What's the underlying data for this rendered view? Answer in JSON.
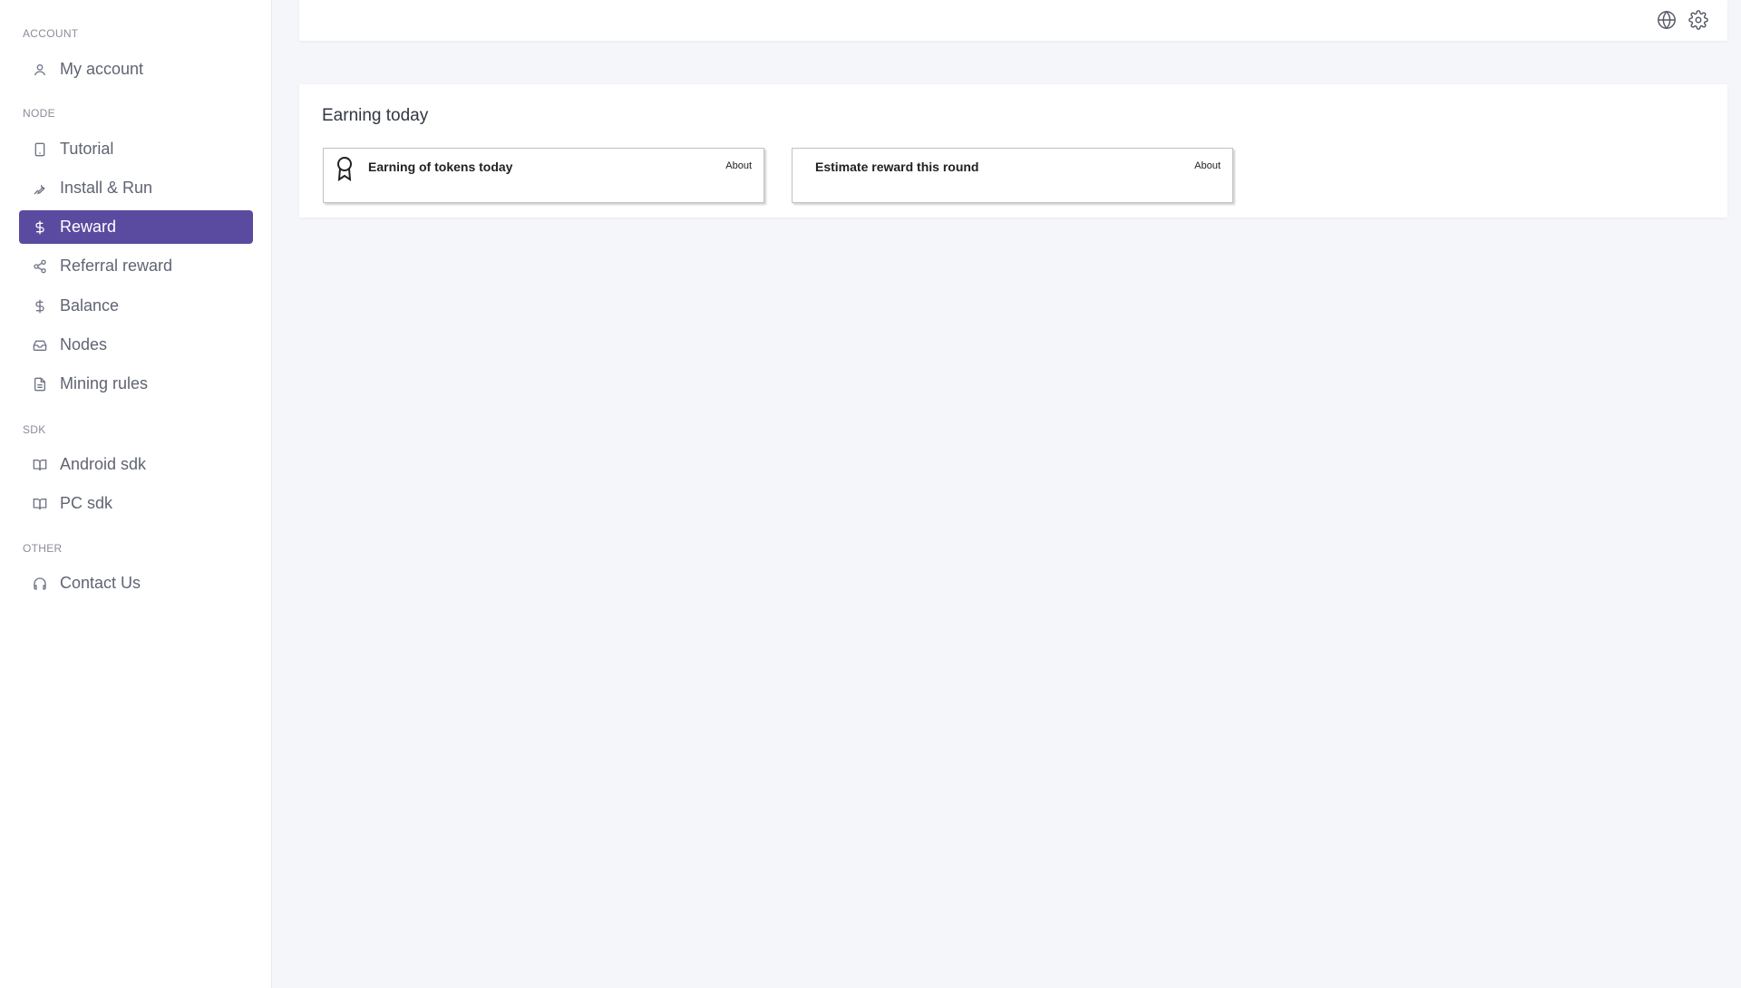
{
  "sidebar": {
    "sections": [
      {
        "label": "ACCOUNT"
      },
      {
        "label": "NODE"
      },
      {
        "label": "SDK"
      },
      {
        "label": "OTHER"
      }
    ],
    "items": [
      {
        "label": "My account",
        "icon": "user-icon"
      },
      {
        "label": "Tutorial",
        "icon": "tablet-icon"
      },
      {
        "label": "Install & Run",
        "icon": "wrench-icon"
      },
      {
        "label": "Reward",
        "icon": "dollar-icon",
        "active": true
      },
      {
        "label": "Referral reward",
        "icon": "share-icon"
      },
      {
        "label": "Balance",
        "icon": "dollar-icon"
      },
      {
        "label": "Nodes",
        "icon": "inbox-icon"
      },
      {
        "label": "Mining rules",
        "icon": "file-icon"
      },
      {
        "label": "Android sdk",
        "icon": "book-icon"
      },
      {
        "label": "PC sdk",
        "icon": "book-icon"
      },
      {
        "label": "Contact Us",
        "icon": "headphones-icon"
      }
    ]
  },
  "topbar": {
    "icons": [
      "globe-icon",
      "gear-icon"
    ]
  },
  "main": {
    "panel_title": "Earning today",
    "cards": [
      {
        "title": "Earning of tokens today",
        "about": "About",
        "icon": "award-icon"
      },
      {
        "title": "Estimate reward this round",
        "about": "About"
      }
    ]
  },
  "colors": {
    "accent": "#5b4ba0",
    "background": "#f5f6fa"
  }
}
